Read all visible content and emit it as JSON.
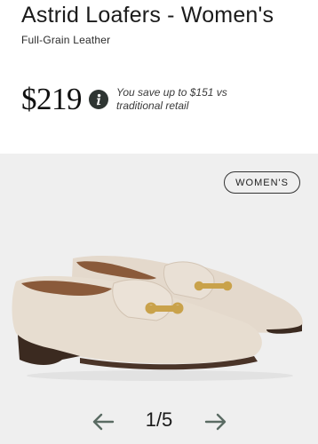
{
  "product": {
    "title": "Astrid Loafers - Women's",
    "subtitle": "Full-Grain Leather",
    "price": "$219",
    "savings_note": "You save up to $151 vs traditional retail"
  },
  "gallery": {
    "badge": "WOMEN'S",
    "page_indicator": "1/5",
    "current_page": 1,
    "total_pages": 5
  },
  "colors": {
    "gallery_bg": "#efefef",
    "info_icon_bg": "#2e3532",
    "leather": "#e7ddd0",
    "sole": "#3b2a20",
    "buckle": "#c9a24b"
  },
  "icons": {
    "info": "info-icon",
    "prev": "arrow-left-icon",
    "next": "arrow-right-icon"
  }
}
